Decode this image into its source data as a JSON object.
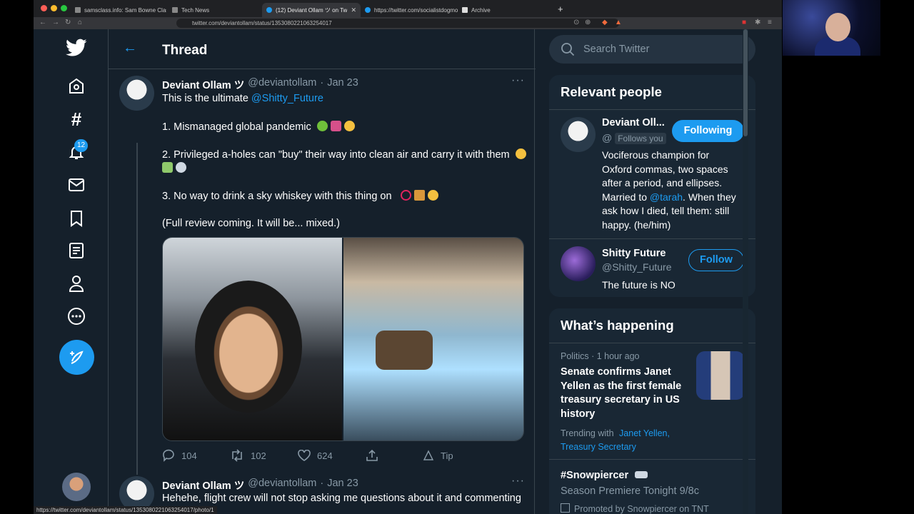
{
  "browser": {
    "tabs": [
      {
        "title": "samsclass.info: Sam Bowne Class..."
      },
      {
        "title": "Tech News"
      },
      {
        "title": "(12) Deviant Ollam ツ on Twitter"
      },
      {
        "title": "https://twitter.com/socialistdogmom"
      },
      {
        "title": "Archive"
      }
    ],
    "url": "twitter.com/deviantollam/status/1353080221063254017",
    "status_url": "https://twitter.com/deviantollam/status/1353080221063254017/photo/1"
  },
  "nav": {
    "notification_count": "12"
  },
  "thread": {
    "title": "Thread",
    "tweet1": {
      "name": "Deviant Ollam ツ",
      "handle": "@deviantollam",
      "sep": "·",
      "date": "Jan 23",
      "intro": "This is the ultimate ",
      "mention": "@Shitty_Future",
      "line1": "1. Mismanaged global pandemic",
      "line2": "2. Privileged a-holes can \"buy\" their way into clean air and carry it with them",
      "line3": "3. No way to drink a sky whiskey with this thing on",
      "line4": "(Full review coming.  It will be... mixed.)",
      "replies": "104",
      "retweets": "102",
      "likes": "624",
      "tip": "Tip"
    },
    "tweet2": {
      "name": "Deviant Ollam ツ",
      "handle": "@deviantollam",
      "sep": "·",
      "date": "Jan 23",
      "text": "Hehehe, flight crew will not stop asking me questions about it and commenting"
    }
  },
  "sidebar": {
    "search_placeholder": "Search Twitter",
    "relevant_title": "Relevant people",
    "person1": {
      "name": "Deviant Oll...",
      "handle": "@",
      "follows_you": "Follows you",
      "button": "Following",
      "bio1": "Vociferous champion for",
      "bio2": "Oxford commas, two spaces",
      "bio3": "after a period, and ellipses.",
      "bio4a": "Married to ",
      "bio4m": "@tarah",
      "bio4b": ". When they",
      "bio5": "ask how I died, tell them: still",
      "bio6": "happy. (he/him)"
    },
    "person2": {
      "name": "Shitty Future",
      "handle": "@Shitty_Future",
      "button": "Follow",
      "bio": "The future is NO"
    },
    "happening_title": "What’s happening",
    "trend1": {
      "meta": "Politics · 1 hour ago",
      "headline1": "Senate confirms Janet",
      "headline2": "Yellen as the first female",
      "headline3": "treasury secretary in US",
      "headline4": "history",
      "trending_prefix": "Trending with ",
      "trending_1": "Janet Yellen,",
      "trending_2": "Treasury Secretary"
    },
    "trend2": {
      "tag": "#Snowpiercer",
      "desc": "Season Premiere Tonight 9/8c",
      "promoted": "Promoted by Snowpiercer on TNT"
    }
  }
}
